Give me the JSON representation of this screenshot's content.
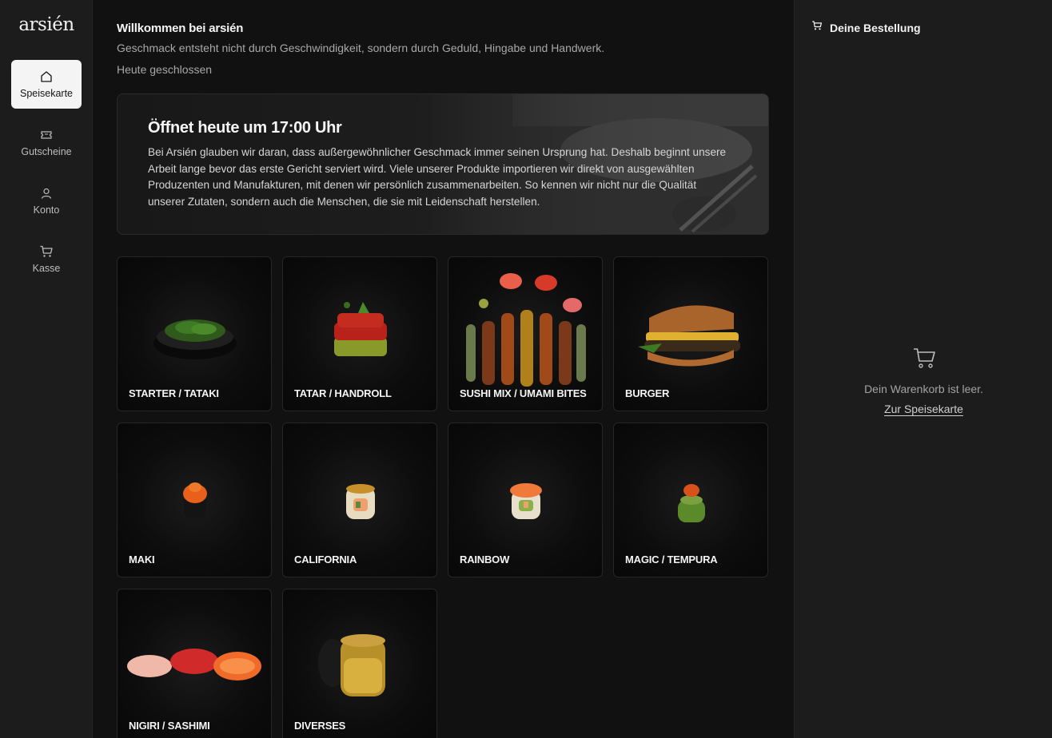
{
  "brand": {
    "logo_text": "arsién"
  },
  "sidebar": {
    "items": [
      {
        "label": "Speisekarte",
        "icon": "home-icon",
        "active": true
      },
      {
        "label": "Gutscheine",
        "icon": "ticket-icon",
        "active": false
      },
      {
        "label": "Konto",
        "icon": "user-icon",
        "active": false
      },
      {
        "label": "Kasse",
        "icon": "cart-icon",
        "active": false
      }
    ]
  },
  "main": {
    "welcome_title": "Willkommen bei arsién",
    "welcome_subtitle": "Geschmack entsteht nicht durch Geschwindigkeit, sondern durch Geduld, Hingabe und Handwerk.",
    "status": "Heute geschlossen",
    "hero": {
      "title": "Öffnet heute um 17:00 Uhr",
      "text": "Bei Arsién glauben wir daran, dass außergewöhnlicher Geschmack immer seinen Ursprung hat. Deshalb beginnt unsere Arbeit lange bevor das erste Gericht serviert wird. Viele unserer Produkte importieren wir direkt von ausgewählten Produzenten und Manufakturen, mit denen wir persönlich zusammenarbeiten. So kennen wir nicht nur die Qualität unserer Zutaten, sondern auch die Menschen, die sie mit Leidenschaft herstellen."
    },
    "categories": [
      {
        "label": "STARTER / TATAKI"
      },
      {
        "label": "TATAR / HANDROLL"
      },
      {
        "label": "SUSHI MIX / UMAMI BITES"
      },
      {
        "label": "BURGER"
      },
      {
        "label": "MAKI"
      },
      {
        "label": "CALIFORNIA"
      },
      {
        "label": "RAINBOW"
      },
      {
        "label": "MAGIC / TEMPURA"
      },
      {
        "label": "NIGIRI / SASHIMI"
      },
      {
        "label": "DIVERSES"
      }
    ]
  },
  "cart": {
    "title": "Deine Bestellung",
    "empty_text": "Dein Warenkorb ist leer.",
    "empty_link": "Zur Speisekarte"
  },
  "colors": {
    "background": "#111111",
    "sidebar": "#1c1c1c",
    "active_nav": "#f4f4f4",
    "text": "#f2f2f2",
    "muted": "#a8a8a8"
  }
}
